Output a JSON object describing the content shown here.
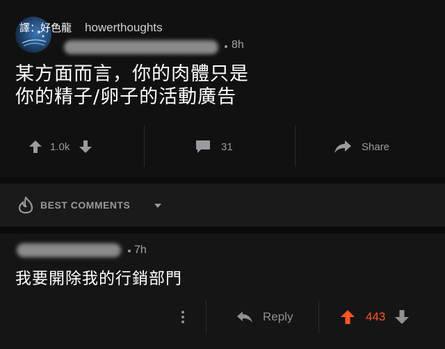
{
  "post": {
    "translator_credit": "譯：好色龍",
    "subreddit": "howerthoughts",
    "age": "8h",
    "title_line1": "某方面而言，你的肉體只是",
    "title_line2": "你的精子/卵子的活動廣告",
    "upvotes": "1.0k",
    "comments": "31",
    "share_label": "Share"
  },
  "sort": {
    "label": "BEST COMMENTS"
  },
  "comment": {
    "age": "7h",
    "text": "我要開除我的行銷部門",
    "reply_label": "Reply",
    "score": "443"
  },
  "colors": {
    "background": "#0b0b0b",
    "upvoted": "#ff5722",
    "muted": "#999ba0"
  },
  "icons": [
    "upvote-arrow-icon",
    "downvote-arrow-icon",
    "comment-bubble-icon",
    "share-arrow-icon",
    "flame-icon",
    "chevron-down-icon",
    "more-dots-icon",
    "reply-arrow-icon"
  ]
}
